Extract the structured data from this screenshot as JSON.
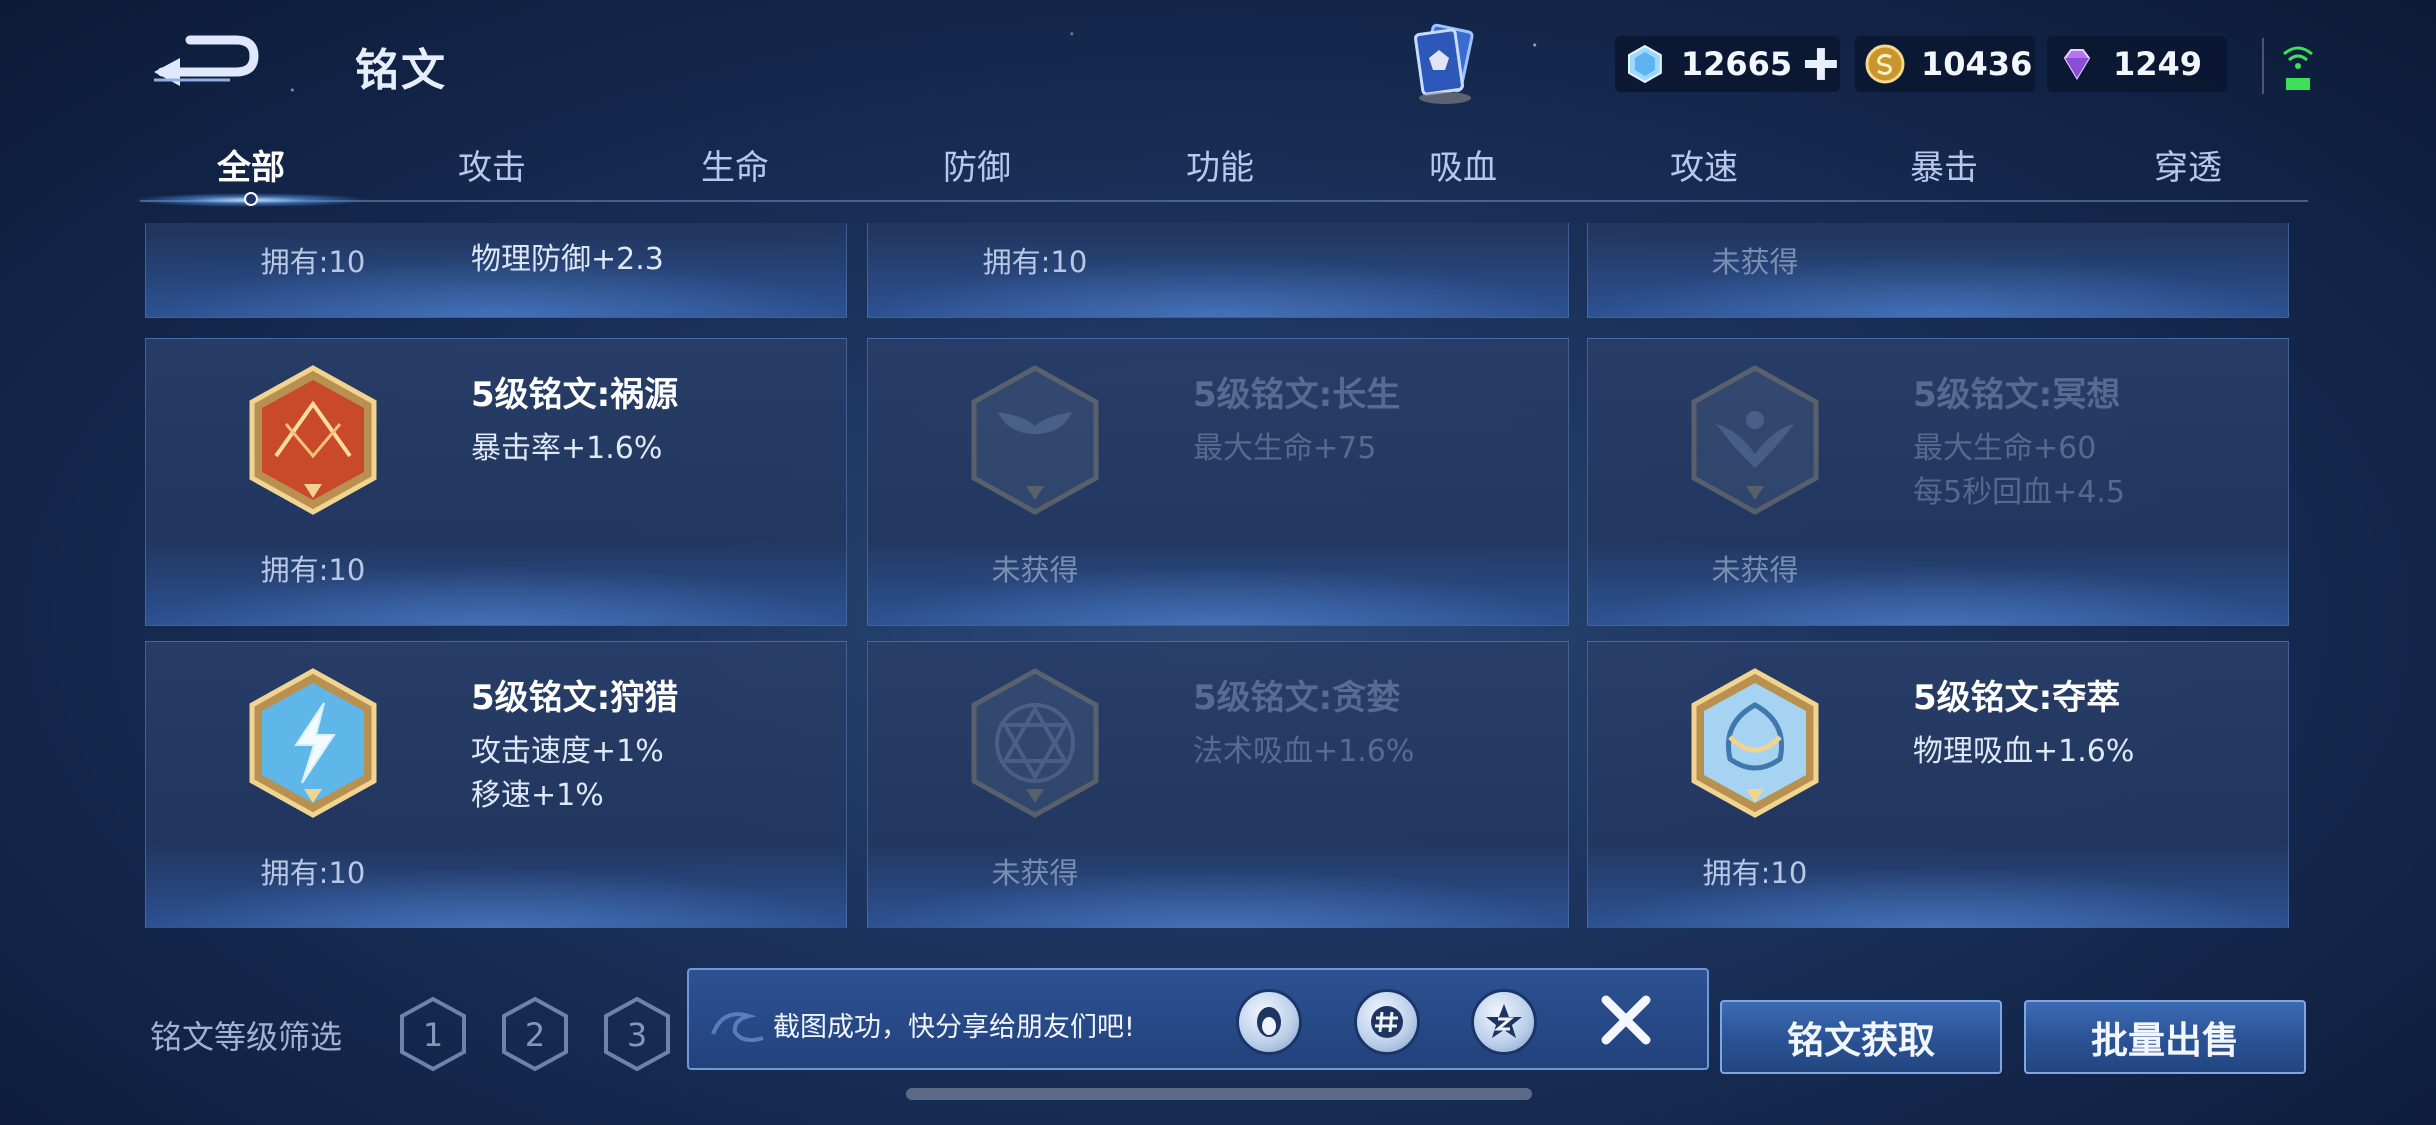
{
  "header": {
    "title": "铭文",
    "currencies": [
      {
        "name": "diamond-icon",
        "amount": "12665"
      },
      {
        "name": "gold-coin-icon",
        "amount": "10436"
      },
      {
        "name": "gem-icon",
        "amount": "1249"
      }
    ]
  },
  "tabs": [
    "全部",
    "攻击",
    "生命",
    "防御",
    "功能",
    "吸血",
    "攻速",
    "暴击",
    "穿透"
  ],
  "active_tab": "全部",
  "inscriptions": [
    {
      "name": "",
      "stats": [
        "物理防御+2.3"
      ],
      "owned": "拥有:10",
      "locked": false,
      "icon": "partial-card"
    },
    {
      "name": "",
      "stats": [],
      "owned": "拥有:10",
      "locked": false,
      "icon": "partial-card"
    },
    {
      "name": "",
      "stats": [],
      "owned": "未获得",
      "locked": true,
      "icon": "partial-card"
    },
    {
      "name": "5级铭文:祸源",
      "stats": [
        "暴击率+1.6%"
      ],
      "owned": "拥有:10",
      "locked": false,
      "icon": "red-sunburst-icon"
    },
    {
      "name": "5级铭文:长生",
      "stats": [
        "最大生命+75"
      ],
      "owned": "未获得",
      "locked": true,
      "icon": "whale-tail-icon"
    },
    {
      "name": "5级铭文:冥想",
      "stats": [
        "最大生命+60",
        "每5秒回血+4.5"
      ],
      "owned": "未获得",
      "locked": true,
      "icon": "bird-icon"
    },
    {
      "name": "5级铭文:狩猎",
      "stats": [
        "攻击速度+1%",
        "移速+1%"
      ],
      "owned": "拥有:10",
      "locked": false,
      "icon": "lightning-icon"
    },
    {
      "name": "5级铭文:贪婪",
      "stats": [
        "法术吸血+1.6%"
      ],
      "owned": "未获得",
      "locked": true,
      "icon": "hexagram-icon"
    },
    {
      "name": "5级铭文:夺萃",
      "stats": [
        "物理吸血+1.6%"
      ],
      "owned": "拥有:10",
      "locked": false,
      "icon": "shield-knot-icon"
    }
  ],
  "filter": {
    "label": "铭文等级筛选",
    "levels": [
      "1",
      "2",
      "3"
    ]
  },
  "toast": {
    "text": "截图成功，快分享给朋友们吧!"
  },
  "buttons": {
    "acquire": "铭文获取",
    "batch_sell": "批量出售"
  },
  "colors": {
    "accent_blue": "#2a5294",
    "emblem_gold": "#d8b56a",
    "background": "#1d3560"
  }
}
